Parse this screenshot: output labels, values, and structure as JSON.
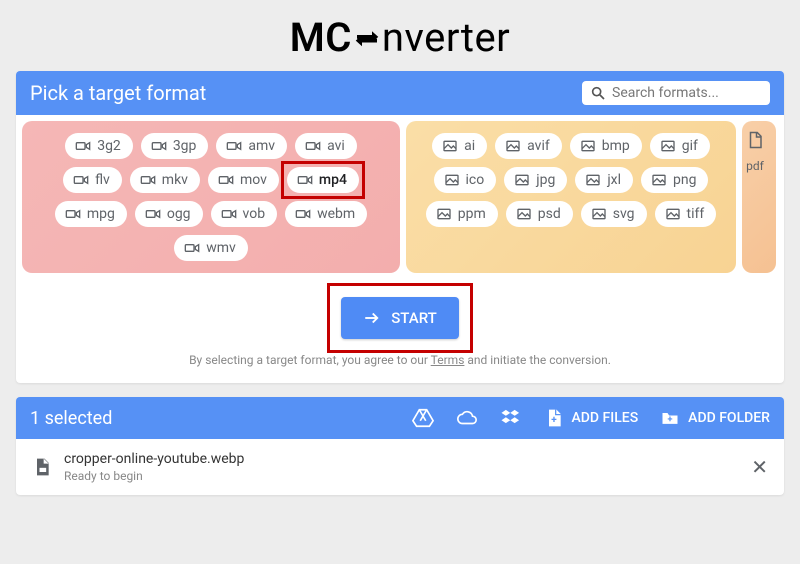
{
  "logo": {
    "pre": "MC",
    "post": "nverter"
  },
  "panel_title": "Pick a target format",
  "search": {
    "placeholder": "Search formats..."
  },
  "video_formats": [
    "3g2",
    "3gp",
    "amv",
    "avi",
    "flv",
    "mkv",
    "mov",
    "mp4",
    "mpg",
    "ogg",
    "vob",
    "webm",
    "wmv"
  ],
  "image_formats": [
    "ai",
    "avif",
    "bmp",
    "gif",
    "ico",
    "jpg",
    "jxl",
    "png",
    "ppm",
    "psd",
    "svg",
    "tiff"
  ],
  "doc_format": "pdf",
  "highlight_format": "mp4",
  "start_label": "START",
  "terms": {
    "pre": "By selecting a target format, you agree to our ",
    "link": "Terms",
    "post": " and initiate the conversion."
  },
  "selected_label": "1 selected",
  "add_files_label": "ADD FILES",
  "add_folder_label": "ADD FOLDER",
  "file": {
    "name": "cropper-online-youtube.webp",
    "status": "Ready to begin"
  },
  "close_glyph": "✕"
}
